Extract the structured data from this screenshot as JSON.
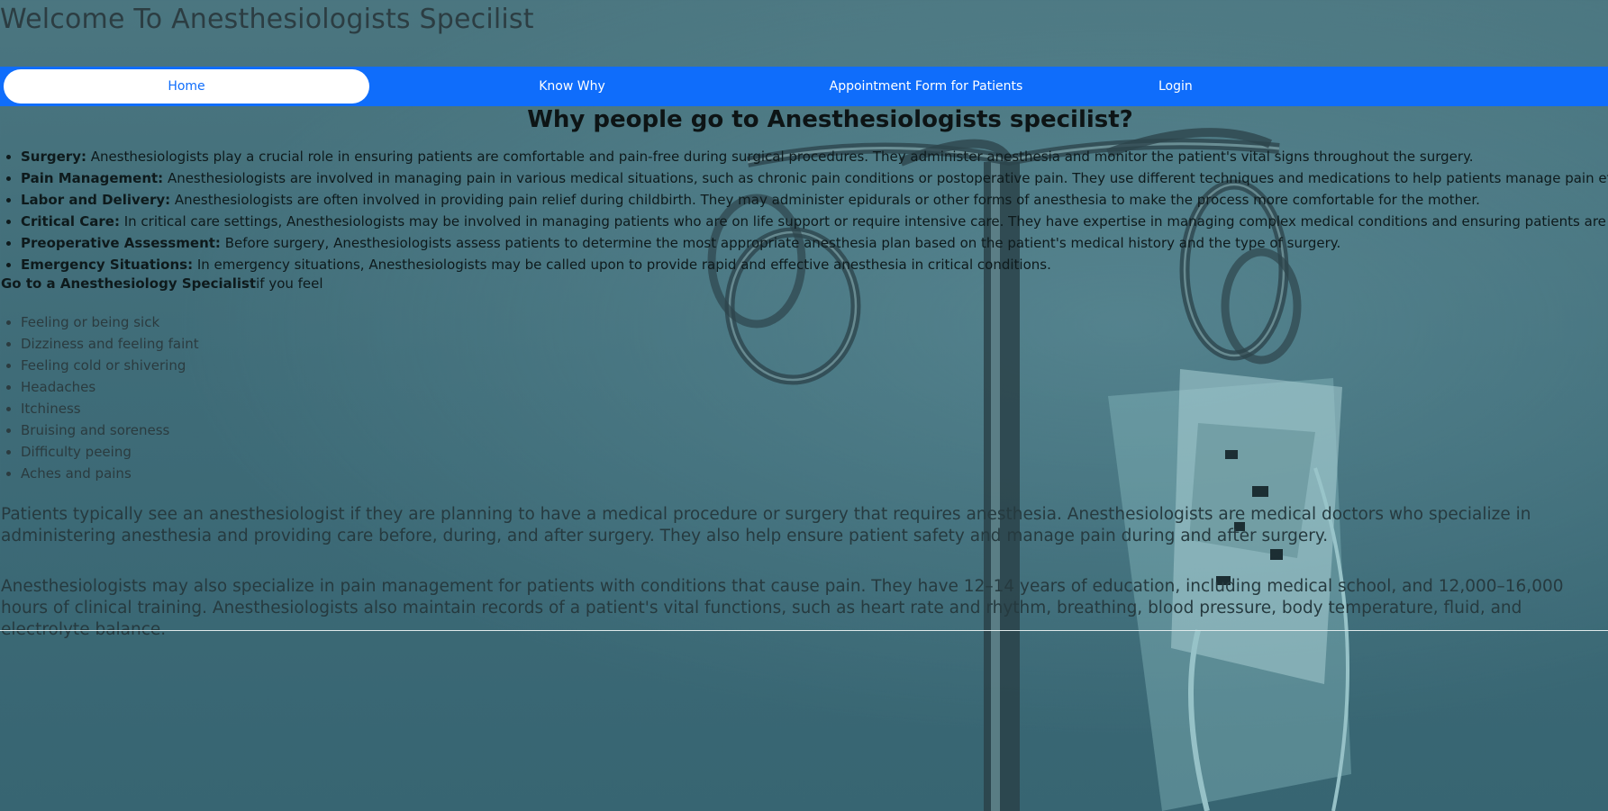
{
  "site": {
    "title": "Welcome To Anesthesiologists Specilist"
  },
  "nav": {
    "items": [
      {
        "label": "Home",
        "active": true
      },
      {
        "label": "Know Why"
      },
      {
        "label": "Appointment Form for Patients"
      },
      {
        "label": "Login"
      }
    ]
  },
  "main": {
    "heading": "Why people go to Anesthesiologists specilist?",
    "reasons": [
      {
        "term": "Surgery:",
        "text": " Anesthesiologists play a crucial role in ensuring patients are comfortable and pain-free during surgical procedures. They administer anesthesia and monitor the patient's vital signs throughout the surgery."
      },
      {
        "term": "Pain Management:",
        "text": " Anesthesiologists are involved in managing pain in various medical situations, such as chronic pain conditions or postoperative pain. They use different techniques and medications to help patients manage pain effectively."
      },
      {
        "term": "Labor and Delivery:",
        "text": " Anesthesiologists are often involved in providing pain relief during childbirth. They may administer epidurals or other forms of anesthesia to make the process more comfortable for the mother."
      },
      {
        "term": "Critical Care:",
        "text": " In critical care settings, Anesthesiologists may be involved in managing patients who are on life support or require intensive care. They have expertise in managing complex medical conditions and ensuring patients are stable."
      },
      {
        "term": "Preoperative Assessment:",
        "text": " Before surgery, Anesthesiologists assess patients to determine the most appropriate anesthesia plan based on the patient's medical history and the type of surgery."
      },
      {
        "term": "Emergency Situations:",
        "text": " In emergency situations, Anesthesiologists may be called upon to provide rapid and effective anesthesia in critical conditions."
      }
    ],
    "go_line": {
      "bold": "Go to a Anesthesiology Specialist",
      "rest": "if you feel"
    },
    "symptoms": [
      "Feeling or being sick",
      "Dizziness and feeling faint",
      "Feeling cold or shivering",
      "Headaches",
      "Itchiness",
      "Bruising and soreness",
      "Difficulty peeing",
      "Aches and pains"
    ],
    "paragraph1": "Patients typically see an anesthesiologist if they are planning to have a medical procedure or surgery that requires anesthesia. Anesthesiologists are medical doctors who specialize in administering anesthesia and providing care before, during, and after surgery. They also help ensure patient safety and manage pain during and after surgery.",
    "paragraph2": "Anesthesiologists may also specialize in pain management for patients with conditions that cause pain. They have 12–14 years of education, including medical school, and 12,000–16,000 hours of clinical training. Anesthesiologists also maintain records of a patient's vital functions, such as heart rate and rhythm, breathing, blood pressure, body temperature, fluid, and electrolyte balance."
  },
  "colors": {
    "nav_bg": "#0f6dfb",
    "page_tint": "#3f6c78"
  },
  "background": {
    "icon": "iv-stand-icon"
  }
}
